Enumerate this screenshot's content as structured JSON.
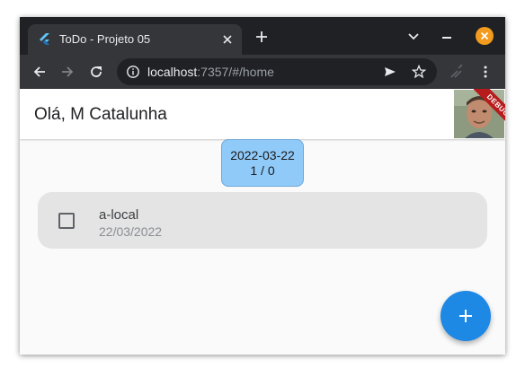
{
  "browser": {
    "tab": {
      "title": "ToDo - Projeto 05",
      "favicon": "flutter-icon"
    },
    "url": {
      "host": "localhost",
      "rest": ":7357/#/home"
    },
    "icons": [
      "back-icon",
      "forward-icon",
      "reload-icon",
      "info-icon",
      "send-icon",
      "star-icon",
      "extensions-icon",
      "menu-icon",
      "new-tab-icon",
      "tab-search-icon",
      "minimize-icon",
      "close-window-icon"
    ],
    "colors": {
      "frame": "#202124",
      "toolbar": "#35363a",
      "close_window": "#f29b1e"
    }
  },
  "app": {
    "greeting": "Olá, M Catalunha",
    "debug_banner": "DEBUG",
    "date_chip": {
      "date": "2022-03-22",
      "count": "1 / 0"
    },
    "todos": [
      {
        "title": "a-local",
        "date": "22/03/2022",
        "checked": false
      }
    ],
    "fab_icon": "plus-icon",
    "colors": {
      "chip": "#90caf9",
      "fab": "#1e88e5",
      "card": "#e4e4e4",
      "debug": "#b71c1c"
    }
  }
}
